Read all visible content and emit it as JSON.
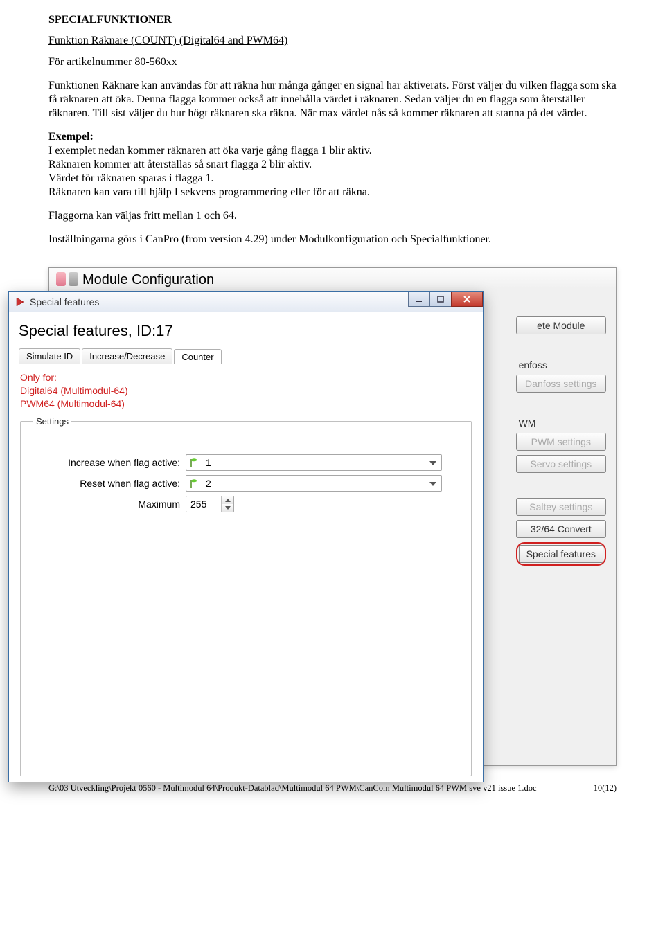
{
  "doc": {
    "heading": "SPECIALFUNKTIONER",
    "subheading": "Funktion Räknare (COUNT) (Digital64 and PWM64)",
    "p1": "För artikelnummer 80-560xx",
    "p2": "Funktionen Räknare kan användas för att räkna hur många gånger en signal har aktiverats. Först väljer du vilken flagga som ska få räknaren att öka. Denna flagga kommer också att innehålla värdet i räknaren. Sedan väljer du en flagga som återställer räknaren. Till sist väljer du hur högt räknaren ska räkna. När max värdet nås så kommer räknaren att stanna på det värdet.",
    "ex_label": "Exempel:",
    "ex1": "I exemplet nedan kommer räknaren att öka varje gång flagga 1 blir aktiv.",
    "ex2": "Räknaren kommer att återställas så snart flagga 2 blir aktiv.",
    "ex3": "Värdet för räknaren sparas i flagga 1.",
    "ex4": "Räknaren kan vara till hjälp I sekvens programmering eller för att räkna.",
    "p3": "Flaggorna kan väljas fritt mellan 1 och 64.",
    "p4": "Inställningarna görs i CanPro (from version 4.29) under Modulkonfiguration och Specialfunktioner."
  },
  "back": {
    "title": "Module Configuration",
    "btn_delete": "ete Module",
    "lbl_enfoss": "enfoss",
    "btn_danfoss": "Danfoss settings",
    "lbl_wm": "WM",
    "btn_pwm": "PWM settings",
    "btn_servo": "Servo settings",
    "btn_saltey": "Saltey settings",
    "btn_convert": "32/64 Convert",
    "btn_special": "Special features"
  },
  "front": {
    "window_title": "Special features",
    "h1": "Special features, ID:17",
    "tabs": {
      "t0": "Simulate ID",
      "t1": "Increase/Decrease",
      "t2": "Counter"
    },
    "onlyfor_l1": "Only for:",
    "onlyfor_l2": "Digital64 (Multimodul-64)",
    "onlyfor_l3": "PWM64 (Multimodul-64)",
    "legend": "Settings",
    "row_increase": "Increase when flag active:",
    "row_reset": "Reset when flag active:",
    "row_max": "Maximum",
    "val_increase": "1",
    "val_reset": "2",
    "val_max": "255"
  },
  "footer": {
    "path": "G:\\03 Utveckling\\Projekt 0560 - Multimodul 64\\Produkt-Datablad\\Multimodul 64 PWM\\CanCom Multimodul 64 PWM sve v21 issue 1.doc",
    "page": "10(12)"
  }
}
